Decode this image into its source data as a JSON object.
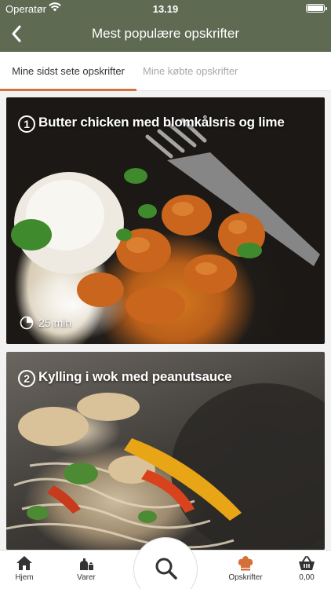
{
  "status_bar": {
    "carrier": "Operatør",
    "time": "13.19"
  },
  "header": {
    "title": "Mest populære opskrifter"
  },
  "tabs": [
    {
      "label": "Mine sidst sete opskrifter",
      "active": true
    },
    {
      "label": "Mine købte opskrifter",
      "active": false
    }
  ],
  "recipes": [
    {
      "number": "1",
      "title": "Butter chicken med blomkålsris og lime",
      "time": "25 min"
    },
    {
      "number": "2",
      "title": "Kylling i wok med peanutsauce"
    }
  ],
  "tabbar": {
    "items": [
      {
        "label": "Hjem",
        "icon": "home-icon"
      },
      {
        "label": "Varer",
        "icon": "groceries-icon"
      },
      {
        "label": "Opskrifter",
        "icon": "chef-hat-icon",
        "active": true
      },
      {
        "label": "0,00",
        "icon": "basket-icon"
      }
    ],
    "search_icon": "search-icon"
  },
  "colors": {
    "header": "#5e6b52",
    "accent": "#d4703a"
  }
}
